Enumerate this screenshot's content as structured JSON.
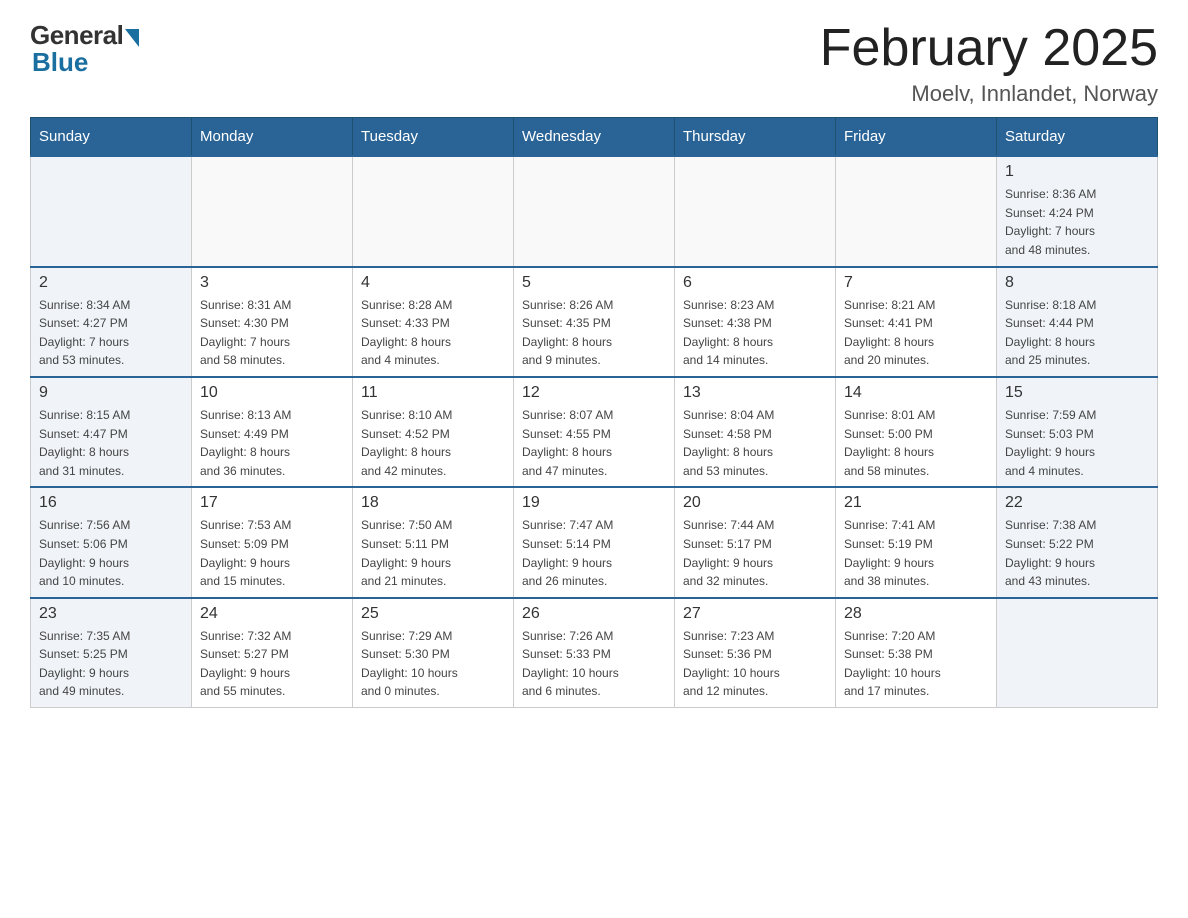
{
  "logo": {
    "general": "General",
    "blue": "Blue"
  },
  "header": {
    "title": "February 2025",
    "subtitle": "Moelv, Innlandet, Norway"
  },
  "weekdays": [
    "Sunday",
    "Monday",
    "Tuesday",
    "Wednesday",
    "Thursday",
    "Friday",
    "Saturday"
  ],
  "weeks": [
    [
      {
        "day": "",
        "info": ""
      },
      {
        "day": "",
        "info": ""
      },
      {
        "day": "",
        "info": ""
      },
      {
        "day": "",
        "info": ""
      },
      {
        "day": "",
        "info": ""
      },
      {
        "day": "",
        "info": ""
      },
      {
        "day": "1",
        "info": "Sunrise: 8:36 AM\nSunset: 4:24 PM\nDaylight: 7 hours\nand 48 minutes."
      }
    ],
    [
      {
        "day": "2",
        "info": "Sunrise: 8:34 AM\nSunset: 4:27 PM\nDaylight: 7 hours\nand 53 minutes."
      },
      {
        "day": "3",
        "info": "Sunrise: 8:31 AM\nSunset: 4:30 PM\nDaylight: 7 hours\nand 58 minutes."
      },
      {
        "day": "4",
        "info": "Sunrise: 8:28 AM\nSunset: 4:33 PM\nDaylight: 8 hours\nand 4 minutes."
      },
      {
        "day": "5",
        "info": "Sunrise: 8:26 AM\nSunset: 4:35 PM\nDaylight: 8 hours\nand 9 minutes."
      },
      {
        "day": "6",
        "info": "Sunrise: 8:23 AM\nSunset: 4:38 PM\nDaylight: 8 hours\nand 14 minutes."
      },
      {
        "day": "7",
        "info": "Sunrise: 8:21 AM\nSunset: 4:41 PM\nDaylight: 8 hours\nand 20 minutes."
      },
      {
        "day": "8",
        "info": "Sunrise: 8:18 AM\nSunset: 4:44 PM\nDaylight: 8 hours\nand 25 minutes."
      }
    ],
    [
      {
        "day": "9",
        "info": "Sunrise: 8:15 AM\nSunset: 4:47 PM\nDaylight: 8 hours\nand 31 minutes."
      },
      {
        "day": "10",
        "info": "Sunrise: 8:13 AM\nSunset: 4:49 PM\nDaylight: 8 hours\nand 36 minutes."
      },
      {
        "day": "11",
        "info": "Sunrise: 8:10 AM\nSunset: 4:52 PM\nDaylight: 8 hours\nand 42 minutes."
      },
      {
        "day": "12",
        "info": "Sunrise: 8:07 AM\nSunset: 4:55 PM\nDaylight: 8 hours\nand 47 minutes."
      },
      {
        "day": "13",
        "info": "Sunrise: 8:04 AM\nSunset: 4:58 PM\nDaylight: 8 hours\nand 53 minutes."
      },
      {
        "day": "14",
        "info": "Sunrise: 8:01 AM\nSunset: 5:00 PM\nDaylight: 8 hours\nand 58 minutes."
      },
      {
        "day": "15",
        "info": "Sunrise: 7:59 AM\nSunset: 5:03 PM\nDaylight: 9 hours\nand 4 minutes."
      }
    ],
    [
      {
        "day": "16",
        "info": "Sunrise: 7:56 AM\nSunset: 5:06 PM\nDaylight: 9 hours\nand 10 minutes."
      },
      {
        "day": "17",
        "info": "Sunrise: 7:53 AM\nSunset: 5:09 PM\nDaylight: 9 hours\nand 15 minutes."
      },
      {
        "day": "18",
        "info": "Sunrise: 7:50 AM\nSunset: 5:11 PM\nDaylight: 9 hours\nand 21 minutes."
      },
      {
        "day": "19",
        "info": "Sunrise: 7:47 AM\nSunset: 5:14 PM\nDaylight: 9 hours\nand 26 minutes."
      },
      {
        "day": "20",
        "info": "Sunrise: 7:44 AM\nSunset: 5:17 PM\nDaylight: 9 hours\nand 32 minutes."
      },
      {
        "day": "21",
        "info": "Sunrise: 7:41 AM\nSunset: 5:19 PM\nDaylight: 9 hours\nand 38 minutes."
      },
      {
        "day": "22",
        "info": "Sunrise: 7:38 AM\nSunset: 5:22 PM\nDaylight: 9 hours\nand 43 minutes."
      }
    ],
    [
      {
        "day": "23",
        "info": "Sunrise: 7:35 AM\nSunset: 5:25 PM\nDaylight: 9 hours\nand 49 minutes."
      },
      {
        "day": "24",
        "info": "Sunrise: 7:32 AM\nSunset: 5:27 PM\nDaylight: 9 hours\nand 55 minutes."
      },
      {
        "day": "25",
        "info": "Sunrise: 7:29 AM\nSunset: 5:30 PM\nDaylight: 10 hours\nand 0 minutes."
      },
      {
        "day": "26",
        "info": "Sunrise: 7:26 AM\nSunset: 5:33 PM\nDaylight: 10 hours\nand 6 minutes."
      },
      {
        "day": "27",
        "info": "Sunrise: 7:23 AM\nSunset: 5:36 PM\nDaylight: 10 hours\nand 12 minutes."
      },
      {
        "day": "28",
        "info": "Sunrise: 7:20 AM\nSunset: 5:38 PM\nDaylight: 10 hours\nand 17 minutes."
      },
      {
        "day": "",
        "info": ""
      }
    ]
  ]
}
